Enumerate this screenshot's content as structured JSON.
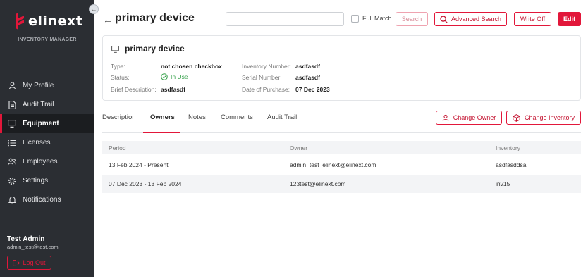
{
  "brand": {
    "logo_text": "elinext",
    "subtitle": "INVENTORY MANAGER",
    "accent": "#e2173a"
  },
  "sidebar": {
    "items": [
      {
        "label": "My Profile",
        "icon": "user-icon"
      },
      {
        "label": "Audit Trail",
        "icon": "document-icon"
      },
      {
        "label": "Equipment",
        "icon": "monitor-icon",
        "active": true
      },
      {
        "label": "Licenses",
        "icon": "list-icon"
      },
      {
        "label": "Employees",
        "icon": "users-icon"
      },
      {
        "label": "Settings",
        "icon": "gear-icon"
      },
      {
        "label": "Notifications",
        "icon": "bell-icon"
      }
    ],
    "user": {
      "name": "Test Admin",
      "email": "admin_test@test.com"
    },
    "logout_label": "Log Out"
  },
  "header": {
    "title": "primary device",
    "search_value": "",
    "full_match_label": "Full Match",
    "search_label": "Search",
    "advanced_search_label": "Advanced Search",
    "write_off_label": "Write Off",
    "edit_label": "Edit"
  },
  "device": {
    "title": "primary device",
    "type_label": "Type:",
    "type_value": "not chosen checkbox",
    "status_label": "Status:",
    "status_value": "In Use",
    "brief_label": "Brief Description:",
    "brief_value": "asdfasdf",
    "inventory_label": "Inventory Number:",
    "inventory_value": "asdfasdf",
    "serial_label": "Serial Number:",
    "serial_value": "asdfasdf",
    "purchase_label": "Date of Purchase:",
    "purchase_value": "07 Dec 2023"
  },
  "tabs": [
    {
      "label": "Description"
    },
    {
      "label": "Owners",
      "active": true
    },
    {
      "label": "Notes"
    },
    {
      "label": "Comments"
    },
    {
      "label": "Audit Trail"
    }
  ],
  "actions": {
    "change_owner_label": "Change Owner",
    "change_inventory_label": "Change Inventory"
  },
  "owners_table": {
    "columns": [
      "Period",
      "Owner",
      "Inventory"
    ],
    "rows": [
      [
        "13 Feb 2024 - Present",
        "admin_test_elinext@elinext.com",
        "asdfasddsa"
      ],
      [
        "07 Dec 2023 - 13 Feb 2024",
        "123test@elinext.com",
        "inv15"
      ]
    ]
  }
}
